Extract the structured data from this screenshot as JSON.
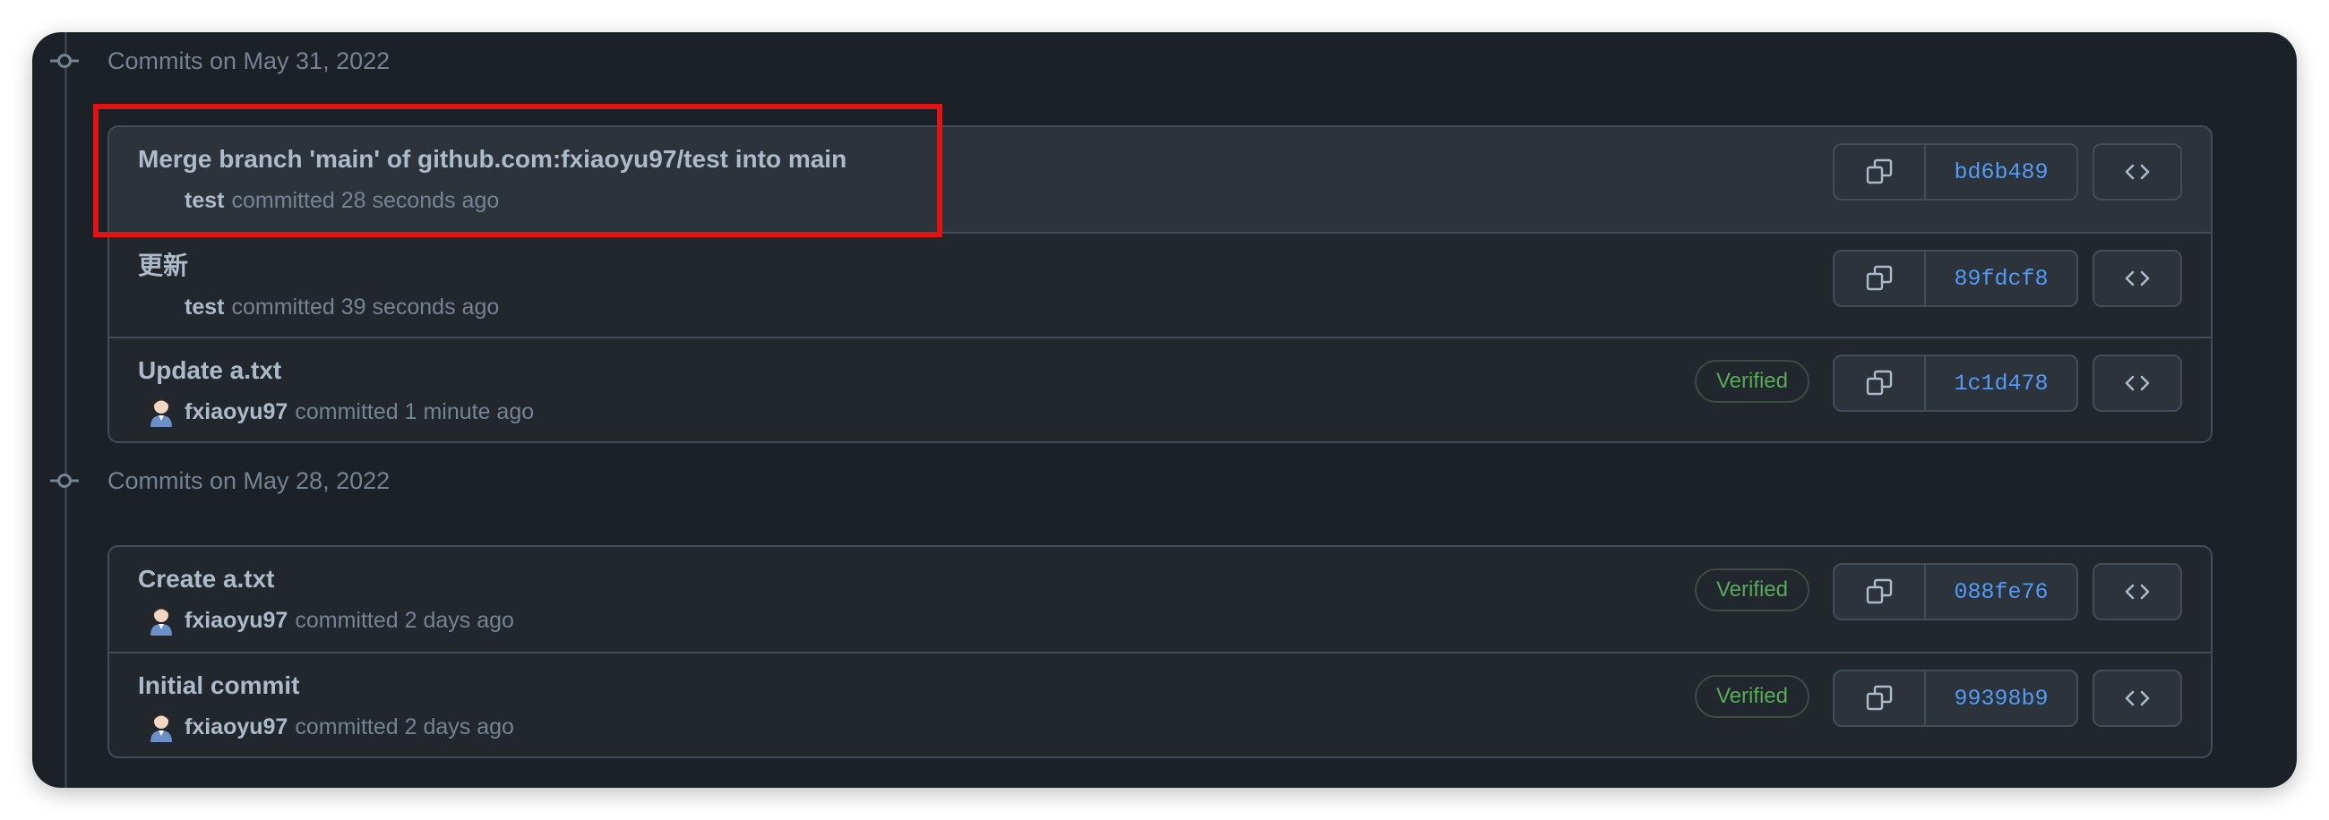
{
  "groups": [
    {
      "date_label": "Commits on May 31, 2022",
      "commits": [
        {
          "title": "Merge branch 'main' of github.com:fxiaoyu97/test into main",
          "author": "test",
          "meta": "committed 28 seconds ago",
          "sha": "bd6b489",
          "verified": false,
          "has_avatar": false,
          "highlighted": true
        },
        {
          "title": "更新",
          "author": "test",
          "meta": "committed 39 seconds ago",
          "sha": "89fdcf8",
          "verified": false,
          "has_avatar": false,
          "highlighted": false
        },
        {
          "title": "Update a.txt",
          "author": "fxiaoyu97",
          "meta": "committed 1 minute ago",
          "sha": "1c1d478",
          "verified": true,
          "has_avatar": true,
          "highlighted": false
        }
      ]
    },
    {
      "date_label": "Commits on May 28, 2022",
      "commits": [
        {
          "title": "Create a.txt",
          "author": "fxiaoyu97",
          "meta": "committed 2 days ago",
          "sha": "088fe76",
          "verified": true,
          "has_avatar": true,
          "highlighted": false
        },
        {
          "title": "Initial commit",
          "author": "fxiaoyu97",
          "meta": "committed 2 days ago",
          "sha": "99398b9",
          "verified": true,
          "has_avatar": true,
          "highlighted": false
        }
      ]
    }
  ],
  "verified_label": "Verified",
  "icons": {
    "timeline": "git-commit-icon",
    "copy": "copy-icon",
    "browse": "code-icon",
    "avatar": "avatar-icon"
  },
  "colors": {
    "background": "#1c2128",
    "sha_link": "#539bf5",
    "verified": "#57ab5a",
    "annotation": "#e01414"
  }
}
